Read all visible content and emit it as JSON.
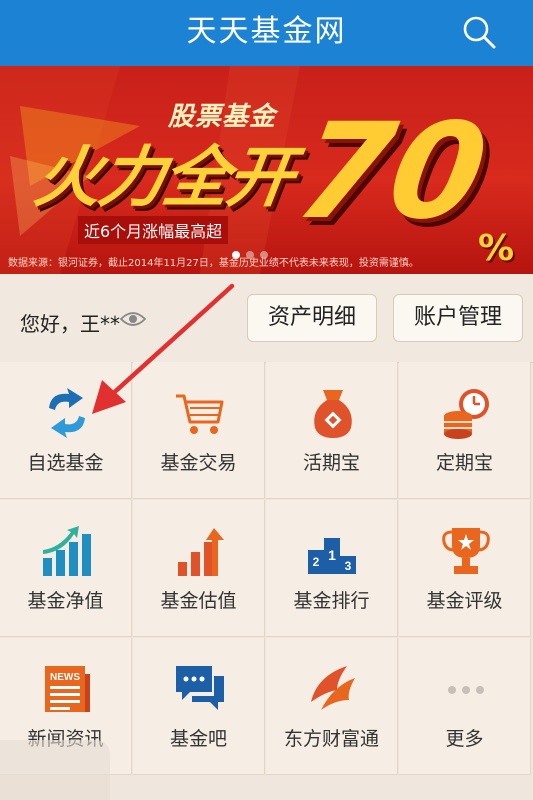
{
  "header": {
    "title": "天天基金网",
    "search_icon": "search-icon"
  },
  "banner": {
    "category": "股票基金",
    "slogan": "火力全开",
    "number": "70",
    "percent": "%",
    "subtitle": "近6个月涨幅最高超",
    "disclaimer": "数据来源：银河证券，截止2014年11月27日，基金历史业绩不代表未来表现，投资需谨慎。",
    "active_slide": 1,
    "slide_count": 3
  },
  "user": {
    "greeting": "您好，王**",
    "eye_icon": "eye-icon",
    "asset_button": "资产明细",
    "account_button": "账户管理"
  },
  "menu": [
    {
      "label": "自选基金",
      "icon": "sync-arrows-icon"
    },
    {
      "label": "基金交易",
      "icon": "shopping-cart-icon"
    },
    {
      "label": "活期宝",
      "icon": "money-bag-icon"
    },
    {
      "label": "定期宝",
      "icon": "coins-clock-icon"
    },
    {
      "label": "基金净值",
      "icon": "growth-bars-icon"
    },
    {
      "label": "基金估值",
      "icon": "rising-bars-icon"
    },
    {
      "label": "基金排行",
      "icon": "podium-icon"
    },
    {
      "label": "基金评级",
      "icon": "trophy-icon"
    },
    {
      "label": "新闻资讯",
      "icon": "newspaper-icon"
    },
    {
      "label": "基金吧",
      "icon": "chat-bubbles-icon"
    },
    {
      "label": "东方财富通",
      "icon": "wing-logo-icon"
    },
    {
      "label": "更多",
      "icon": "more-dots-icon"
    }
  ],
  "colors": {
    "header": "#1c82d4",
    "banner": "#c8201a",
    "accent_orange": "#e8661e",
    "accent_blue": "#1c6fb4",
    "arrow": "#e03030"
  }
}
